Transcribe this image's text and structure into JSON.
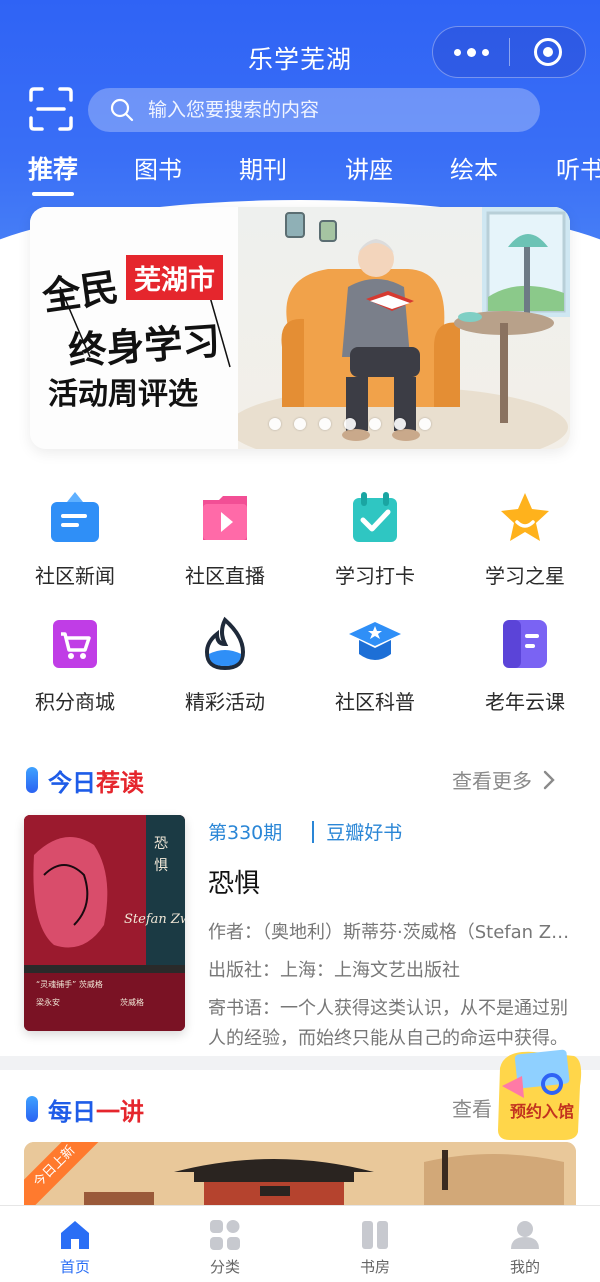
{
  "header": {
    "title": "乐学芜湖",
    "search_placeholder": "输入您要搜索的内容",
    "tabs": [
      "推荐",
      "图书",
      "期刊",
      "讲座",
      "绘本",
      "听书"
    ]
  },
  "banner": {
    "tag": "芜湖市",
    "line1": "全民",
    "line2": "终身学习",
    "line3": "活动周评选",
    "slide_count": 7,
    "active_slide": 1
  },
  "grid": [
    {
      "label": "社区新闻",
      "icon": "news-icon",
      "color": "#2f8ff7"
    },
    {
      "label": "社区直播",
      "icon": "live-icon",
      "color": "#f24f95"
    },
    {
      "label": "学习打卡",
      "icon": "checkin-icon",
      "color": "#2fc6c2"
    },
    {
      "label": "学习之星",
      "icon": "star-icon",
      "color": "#ffb21c"
    },
    {
      "label": "积分商城",
      "icon": "cart-icon",
      "color": "#c03de6"
    },
    {
      "label": "精彩活动",
      "icon": "flame-icon",
      "color": "#2f8ff7"
    },
    {
      "label": "社区科普",
      "icon": "graduation-cap-icon",
      "color": "#2f8ff7"
    },
    {
      "label": "老年云课",
      "icon": "book-icon",
      "color": "#7a63f3"
    }
  ],
  "today": {
    "title_part1": "今日",
    "title_part2": "荐读",
    "more": "查看更多",
    "issue": "第330期",
    "column": "豆瓣好书",
    "book_title": "恐惧",
    "author": "作者：（奥地利）斯蒂芬·茨威格（Stefan Zweig）著",
    "publisher": "出版社：上海：上海文艺出版社",
    "intro": "寄书语：一个人获得这类认识，从不是通过别人的经验，而始终只能从自己的命运中获得。",
    "cover_title": "恐惧"
  },
  "daily": {
    "title_part1": "每日",
    "title_part2": "一讲",
    "more": "查看",
    "ribbon": "今日上新"
  },
  "reserve": {
    "label": "预约入馆"
  },
  "nav": [
    {
      "label": "首页",
      "icon": "home-icon",
      "active": true
    },
    {
      "label": "分类",
      "icon": "category-icon",
      "active": false
    },
    {
      "label": "书房",
      "icon": "bookshelf-icon",
      "active": false
    },
    {
      "label": "我的",
      "icon": "user-icon",
      "active": false
    }
  ],
  "colors": {
    "primary": "#2f63f5",
    "accent_red": "#e5262d",
    "link_blue": "#2a86d6"
  }
}
